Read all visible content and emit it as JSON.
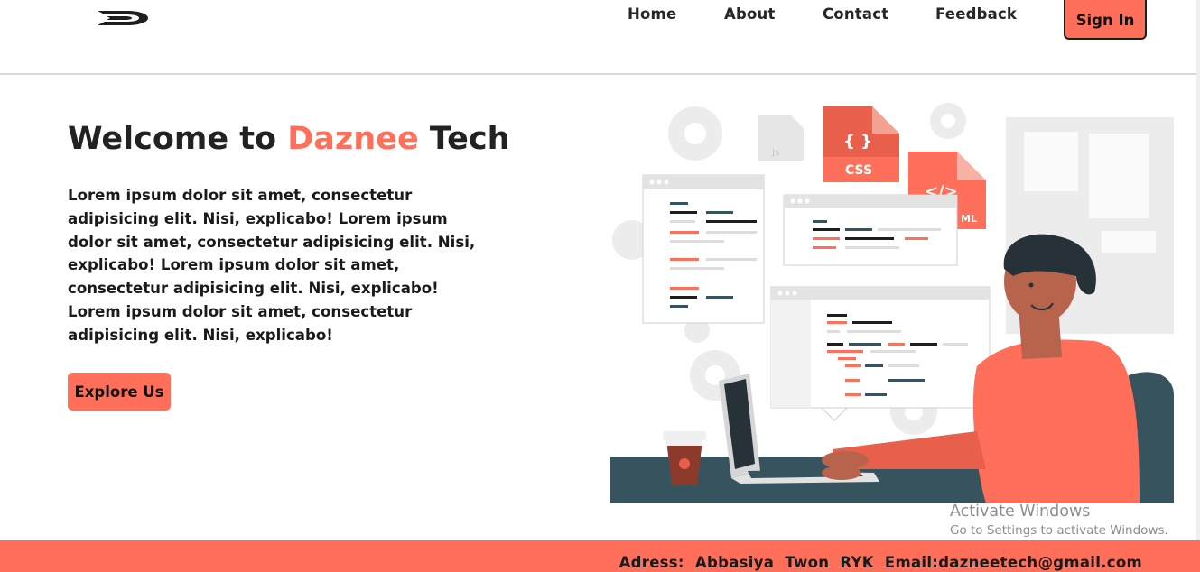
{
  "header": {
    "logo_alt": "D",
    "nav": {
      "home": "Home",
      "about": "About",
      "contact": "Contact",
      "feedback": "Feedback"
    },
    "sign_in": "Sign In"
  },
  "hero": {
    "title_prefix": "Welcome to ",
    "title_accent": "Daznee",
    "title_suffix": " Tech",
    "text": "Lorem ipsum dolor sit amet, consectetur adipisicing elit. Nisi, explicabo! Lorem ipsum dolor sit amet, consectetur adipisicing elit. Nisi, explicabo! Lorem ipsum dolor sit amet, consectetur adipisicing elit. Nisi, explicabo! Lorem ipsum dolor sit amet, consectetur adipisicing elit. Nisi, explicabo!",
    "button": "Explore Us",
    "illustration": {
      "css_label": "CSS",
      "css_braces": "{ }",
      "html_label": "</>",
      "html_partial": "ML",
      "js_label": "Js"
    }
  },
  "watermark": {
    "line1": "Activate Windows",
    "line2": "Go to Settings to activate Windows."
  },
  "footer": {
    "text": "Adress:  Abbasiya  Twon  RYK  Email:dazneetech@gmail.com"
  },
  "colors": {
    "accent": "#ff6f59",
    "dark": "#1e1e1e",
    "desk": "#37545e"
  },
  "icons": [
    "logo-d-icon",
    "gear-icon",
    "document-icon",
    "coffee-cup-icon",
    "laptop-icon"
  ]
}
